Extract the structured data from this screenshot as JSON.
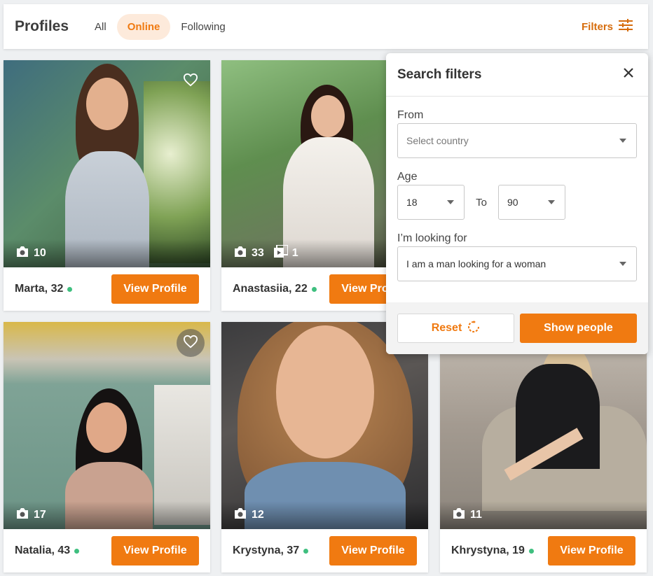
{
  "header": {
    "title": "Profiles",
    "tabs": [
      {
        "label": "All",
        "active": false
      },
      {
        "label": "Online",
        "active": true
      },
      {
        "label": "Following",
        "active": false
      }
    ],
    "filters_label": "Filters",
    "filters_icon": "sliders-icon"
  },
  "profiles": [
    {
      "name": "Marta, 32",
      "online": true,
      "photos": "10",
      "videos": "",
      "view_label": "View Profile",
      "favorite_icon": "heart-icon"
    },
    {
      "name": "Anastasiia, 22",
      "online": true,
      "photos": "33",
      "videos": "1",
      "view_label": "View Profile",
      "favorite_icon": ""
    },
    {
      "name": "Natalia, 43",
      "online": true,
      "photos": "17",
      "videos": "",
      "view_label": "View Profile",
      "favorite_icon": "heart-icon"
    },
    {
      "name": "Krystyna, 37",
      "online": true,
      "photos": "12",
      "videos": "",
      "view_label": "View Profile",
      "favorite_icon": ""
    },
    {
      "name": "Khrystyna, 19",
      "online": true,
      "photos": "11",
      "videos": "",
      "view_label": "View Profile",
      "favorite_icon": ""
    }
  ],
  "search_filters": {
    "title": "Search filters",
    "from_label": "From",
    "country_placeholder": "Select country",
    "age_label": "Age",
    "age_from": "18",
    "to_label": "To",
    "age_to": "90",
    "looking_for_label": "I’m looking for",
    "looking_for_value": "I am a man looking for a woman",
    "reset_label": "Reset",
    "show_label": "Show people"
  },
  "colors": {
    "accent": "#f07a11",
    "online": "#3fbf7f"
  }
}
